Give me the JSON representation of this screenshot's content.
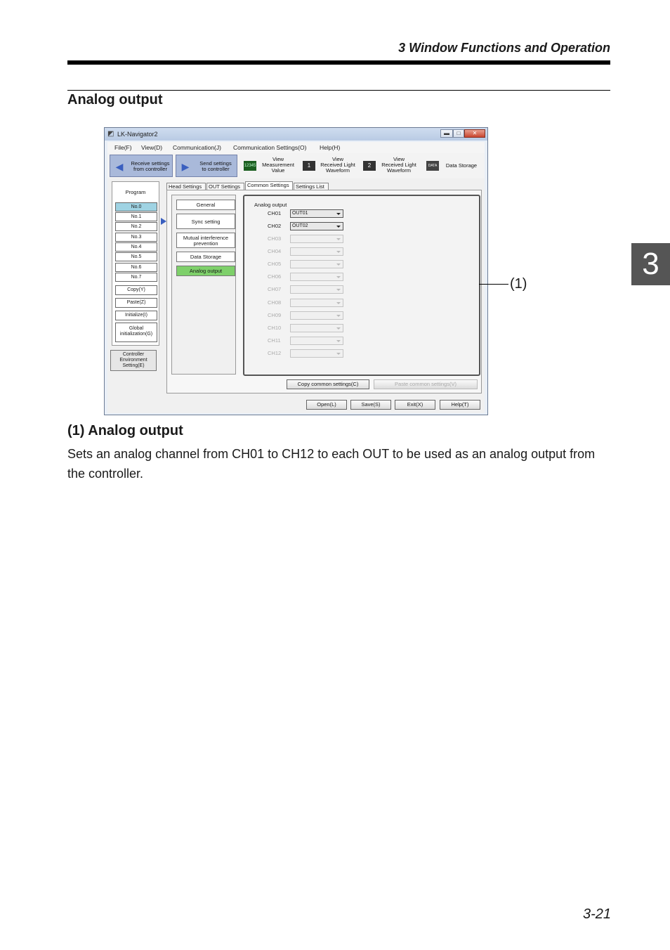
{
  "page": {
    "header": "3  Window Functions and Operation",
    "section_title": "Analog output",
    "chapter_tab": "3",
    "callout": "(1)",
    "subsection_title": "(1)  Analog output",
    "body_text": "Sets an analog channel from CH01 to CH12 to each OUT to be used as an analog output from the controller.",
    "page_number": "3-21"
  },
  "window": {
    "title": "LK-Navigator2",
    "controls": {
      "minimize": "▬",
      "maximize": "□",
      "close": "✕"
    },
    "menu": [
      "File(F)",
      "View(D)",
      "Communication(J)",
      "Communication Settings(O)",
      "Help(H)"
    ],
    "toolbar": {
      "receive": "Receive settings\nfrom controller",
      "send": "Send settings\nto controller",
      "view_measurement": "View\nMeasurement\nValue",
      "view_light_1": "View\nReceived Light\nWaveform",
      "view_light_2": "View\nReceived Light\nWaveform",
      "data_storage": "Data Storage",
      "icon_measurement": "12345",
      "icon_1": "1",
      "icon_2": "2",
      "icon_data": "DATA"
    },
    "program": {
      "label": "Program",
      "items": [
        "No.0",
        "No.1",
        "No.2",
        "No.3",
        "No.4",
        "No.5",
        "No.6",
        "No.7"
      ],
      "copy": "Copy(Y)",
      "paste": "Paste(Z)",
      "initialize": "Initialize(I)",
      "global_init": "Global\ninitialization(G)",
      "env_settings": "Controller\nEnvironment\nSetting(E)"
    },
    "tabs": [
      "Head Settings",
      "OUT Settings",
      "Common Settings",
      "Settings List"
    ],
    "side_menu": [
      "General",
      "Sync setting",
      "Mutual interference\nprevention",
      "Data Storage",
      "Analog output"
    ],
    "analog_output": {
      "group_label": "Analog output",
      "channels": [
        {
          "label": "CH01",
          "value": "OUT01"
        },
        {
          "label": "CH02",
          "value": "OUT02"
        },
        {
          "label": "CH03",
          "value": ""
        },
        {
          "label": "CH04",
          "value": ""
        },
        {
          "label": "CH05",
          "value": ""
        },
        {
          "label": "CH06",
          "value": ""
        },
        {
          "label": "CH07",
          "value": ""
        },
        {
          "label": "CH08",
          "value": ""
        },
        {
          "label": "CH09",
          "value": ""
        },
        {
          "label": "CH10",
          "value": ""
        },
        {
          "label": "CH11",
          "value": ""
        },
        {
          "label": "CH12",
          "value": ""
        }
      ]
    },
    "copy_common": "Copy common settings(C)",
    "paste_common": "Paste common settings(V)",
    "footer_buttons": [
      "Open(L)",
      "Save(S)",
      "Exit(X)",
      "Help(T)"
    ]
  }
}
